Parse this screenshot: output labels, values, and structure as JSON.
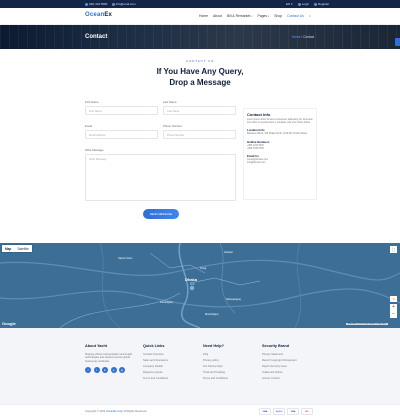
{
  "topbar": {
    "phone": "(00) 444 5081",
    "email": "info@mail.com",
    "language": "EN",
    "login": "Login",
    "register": "Register"
  },
  "logo": {
    "part1": "Ocean",
    "part2": "Ex"
  },
  "nav": {
    "items": [
      "Home",
      "About",
      "Bill & Remarket",
      "Pages",
      "Shop",
      "Contact Us"
    ]
  },
  "hero": {
    "title": "Contact",
    "breadcrumb_home": "Home",
    "breadcrumb_sep": "/",
    "breadcrumb_current": "Contact"
  },
  "section": {
    "eyebrow": "CONTACT US",
    "heading_line1": "If You Have Any Query,",
    "heading_line2": "Drop a Message"
  },
  "form": {
    "first_name_label": "First Name",
    "first_name_placeholder": "First Name",
    "last_name_label": "Last Name",
    "last_name_placeholder": "Last Name",
    "email_label": "Email",
    "email_placeholder": "Email Address",
    "phone_label": "Phone Number",
    "phone_placeholder": "Phone Number",
    "message_label": "Write Message",
    "message_placeholder": "Write Message",
    "submit_label": "SEND MESSAGE"
  },
  "info": {
    "title": "Contact Info",
    "text": "Lorem ipsum dolor sit amet consectetur adipiscing elit. Duis aute irure dolor in reprehenderit in voluptate velit esse cillum dolore.",
    "location_title": "Location Info",
    "location_value": "Banasree Block, 165 Dhaka North, 1219 Rd 13 Main Road",
    "hotline_title": "Hotline Numbers",
    "hotline_1": "+880 1234 5678",
    "hotline_2": "+880 2345 6789",
    "email_title": "Email Us",
    "email_1": "ocean@domain.com",
    "email_2": "info@domain.com"
  },
  "map": {
    "tab_map": "Map",
    "tab_satellite": "Satellite",
    "google": "Google",
    "footer_text": "Map data ©2023  Terms  Report a map error",
    "label_city": "Dhaka",
    "label_city_local": "ঢাকা",
    "label_savar": "Savar Union",
    "label_gazipur": "Gazipur",
    "label_narayanganj": "Narayanganj",
    "label_keraniganj": "Keraniganj",
    "label_tongi": "Tongi",
    "label_munshiganj": "Munshiganj"
  },
  "footer": {
    "about_title": "About Yacht",
    "about_text": "Shaping efficient transportation and freight technologies and solutions across global businesses worldwide.",
    "socials": [
      "f",
      "t",
      "in",
      "p",
      "ig"
    ],
    "quick_title": "Quick Links",
    "quick_links": [
      "Contact Overview",
      "Sales and Operations",
      "Company Details",
      "Request a Quote",
      "Terms and Conditions"
    ],
    "help_title": "Need Help?",
    "help_links": [
      "FAQ",
      "Privacy policy",
      "Our Partnerships",
      "Track and Tracking",
      "Terms and Conditions"
    ],
    "security_title": "Security Brand",
    "security_links": [
      "Privacy Statement",
      "Report Copyright Infringement",
      "Report Security Issue",
      "Trademark Notice",
      "Access Control"
    ]
  },
  "bottom": {
    "copyright_prefix": "Copyright © 2023",
    "brand": "OceanEx Corp",
    "copyright_suffix": "All Rights Reserved.",
    "payments": [
      "VISA",
      "PayPal",
      "VISA",
      "MC"
    ]
  },
  "colors": {
    "accent": "#2f6fd6",
    "dark": "#0e1f3d",
    "topbar": "#13264a",
    "map_water": "#3d6e95"
  }
}
